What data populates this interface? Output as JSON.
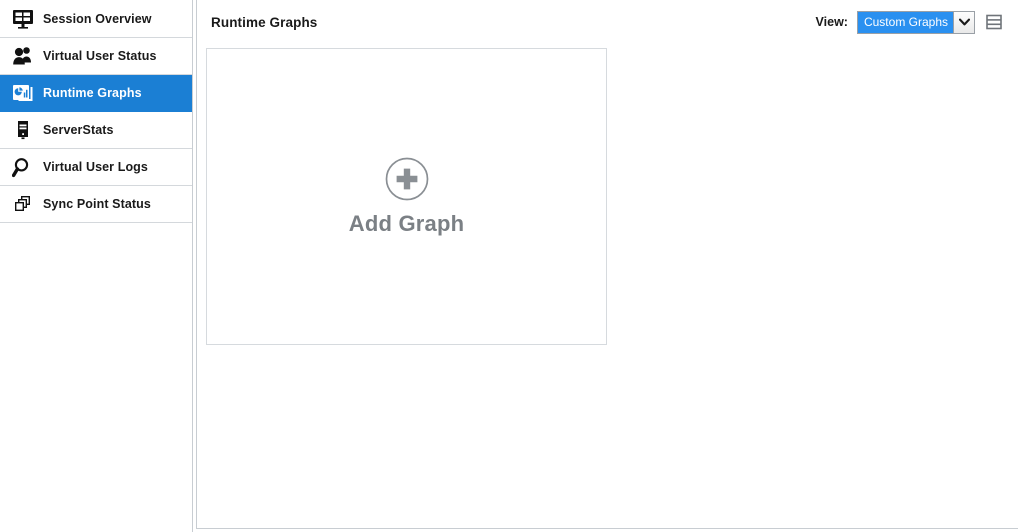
{
  "sidebar": {
    "items": [
      {
        "label": "Session Overview",
        "icon": "monitor-icon",
        "selected": false
      },
      {
        "label": "Virtual User Status",
        "icon": "users-icon",
        "selected": false
      },
      {
        "label": "Runtime Graphs",
        "icon": "chart-icon",
        "selected": true
      },
      {
        "label": "ServerStats",
        "icon": "server-icon",
        "selected": false
      },
      {
        "label": "Virtual User Logs",
        "icon": "magnifier-icon",
        "selected": false
      },
      {
        "label": "Sync Point Status",
        "icon": "layers-icon",
        "selected": false
      }
    ],
    "selected_color": "#1b7fd4"
  },
  "header": {
    "title": "Runtime Graphs",
    "view_label": "View:",
    "view_value": "Custom Graphs",
    "view_options": [
      "Custom Graphs"
    ],
    "dropdown_icon": "chevron-down-icon",
    "layout_icon": "horizontal-split-layout-icon",
    "selection_color": "#2a90f0"
  },
  "content": {
    "add_graph": {
      "icon": "plus-circle-icon",
      "label": "Add Graph",
      "text_color": "#7b8085"
    }
  }
}
